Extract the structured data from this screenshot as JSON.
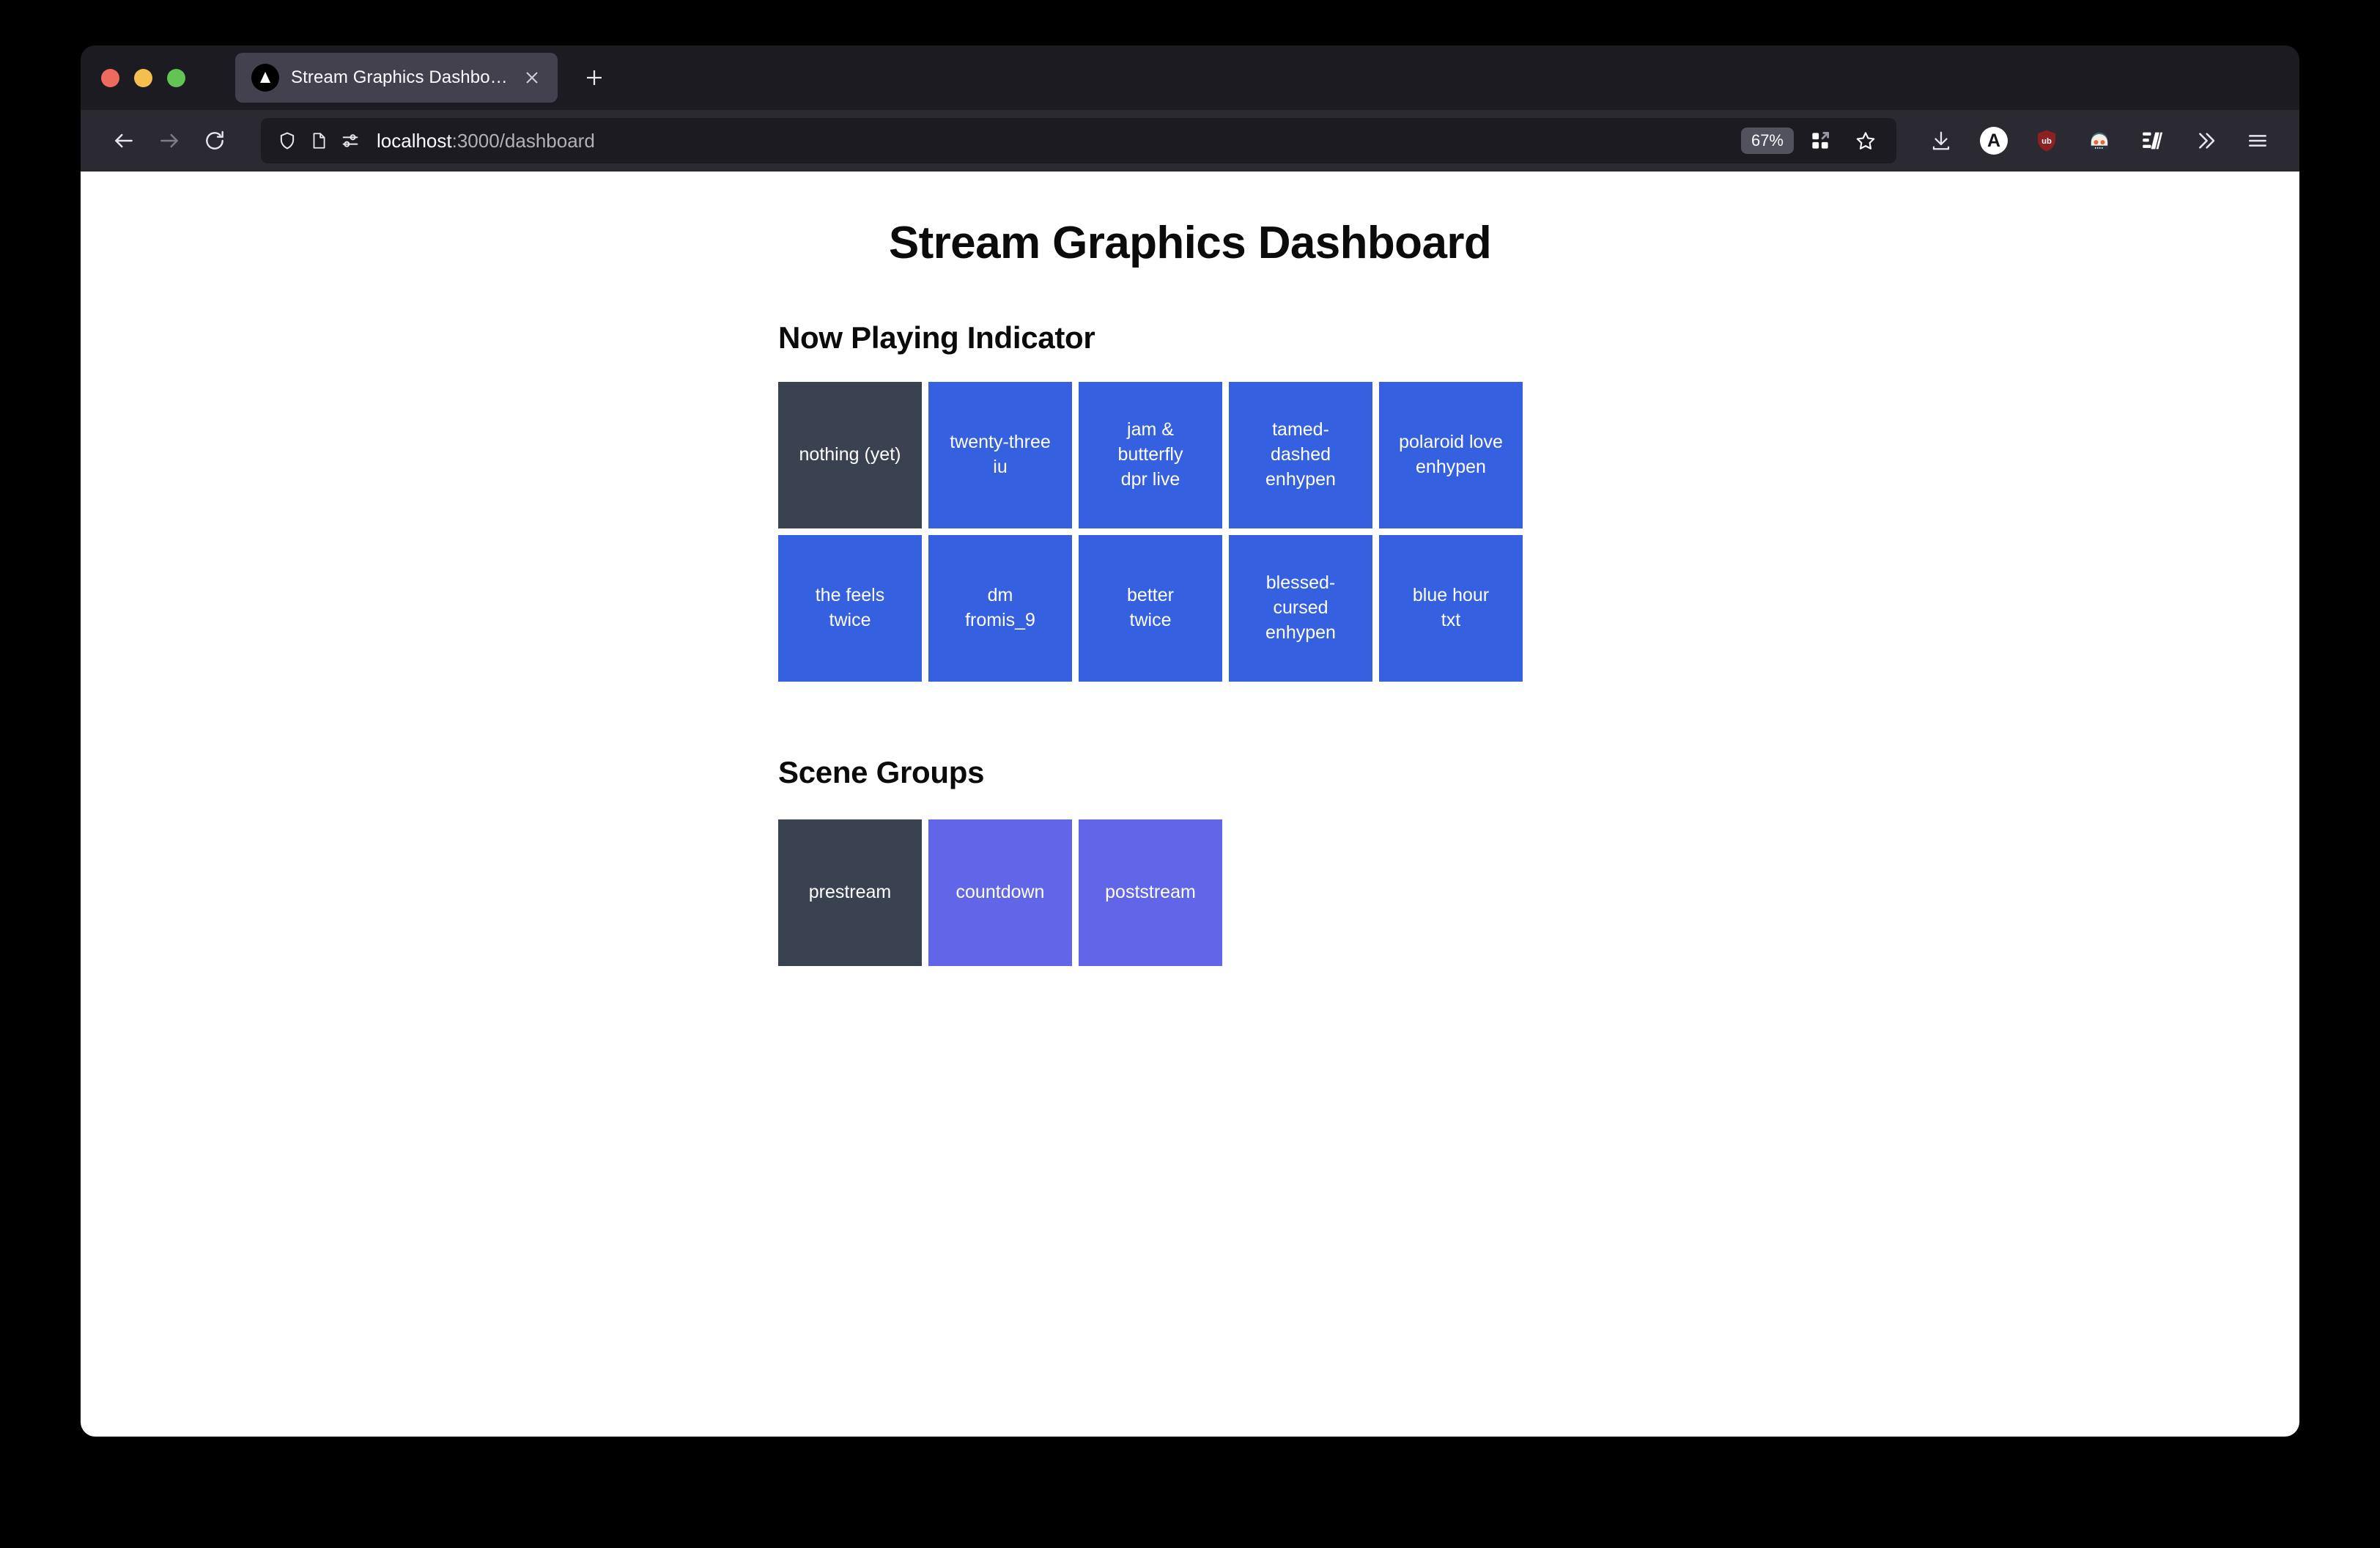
{
  "window": {
    "traffic_lights": [
      "close",
      "minimize",
      "maximize"
    ]
  },
  "tab": {
    "title": "Stream Graphics Dashboard",
    "favicon": "triangle-logo-icon",
    "close_icon": "close-icon",
    "new_tab_icon": "plus-icon"
  },
  "toolbar": {
    "back_icon": "back-arrow-icon",
    "forward_icon": "forward-arrow-icon",
    "reload_icon": "reload-icon",
    "shield_icon": "shield-icon",
    "reader_icon": "page-reader-icon",
    "permissions_icon": "sliders-icon",
    "url_host": "localhost",
    "url_path": ":3000/dashboard",
    "zoom_level": "67%",
    "extensions_icon": "extensions-grid-icon",
    "bookmark_icon": "star-icon",
    "downloads_icon": "download-icon",
    "account_icon": "account-a-icon",
    "ublock_icon": "ublock-shield-icon",
    "avatar_icon": "avatar-glasses-icon",
    "editor_icon": "stripes-editor-icon",
    "overflow_icon": "double-chevron-icon",
    "menu_icon": "hamburger-menu-icon"
  },
  "page": {
    "title": "Stream Graphics Dashboard",
    "sections": [
      {
        "heading": "Now Playing Indicator",
        "tiles": [
          {
            "lines": [
              "nothing (yet)"
            ],
            "state": "idle"
          },
          {
            "lines": [
              "twenty-three",
              "iu"
            ],
            "state": "track"
          },
          {
            "lines": [
              "jam &",
              "butterfly",
              "dpr live"
            ],
            "state": "track"
          },
          {
            "lines": [
              "tamed-",
              "dashed",
              "enhypen"
            ],
            "state": "track"
          },
          {
            "lines": [
              "polaroid love",
              "enhypen"
            ],
            "state": "track"
          },
          {
            "lines": [
              "the feels",
              "twice"
            ],
            "state": "track"
          },
          {
            "lines": [
              "dm",
              "fromis_9"
            ],
            "state": "track"
          },
          {
            "lines": [
              "better",
              "twice"
            ],
            "state": "track"
          },
          {
            "lines": [
              "blessed-",
              "cursed",
              "enhypen"
            ],
            "state": "track"
          },
          {
            "lines": [
              "blue hour",
              "txt"
            ],
            "state": "track"
          }
        ]
      },
      {
        "heading": "Scene Groups",
        "tiles": [
          {
            "lines": [
              "prestream"
            ],
            "state": "idle"
          },
          {
            "lines": [
              "countdown"
            ],
            "state": "scene"
          },
          {
            "lines": [
              "poststream"
            ],
            "state": "scene"
          }
        ]
      }
    ]
  },
  "colors": {
    "idle": "#3a4251",
    "track": "#3560e0",
    "scene": "#6165e8",
    "page_bg": "#ffffff",
    "chrome_bg": "#2b2a33",
    "tabstrip_bg": "#1c1b22"
  }
}
